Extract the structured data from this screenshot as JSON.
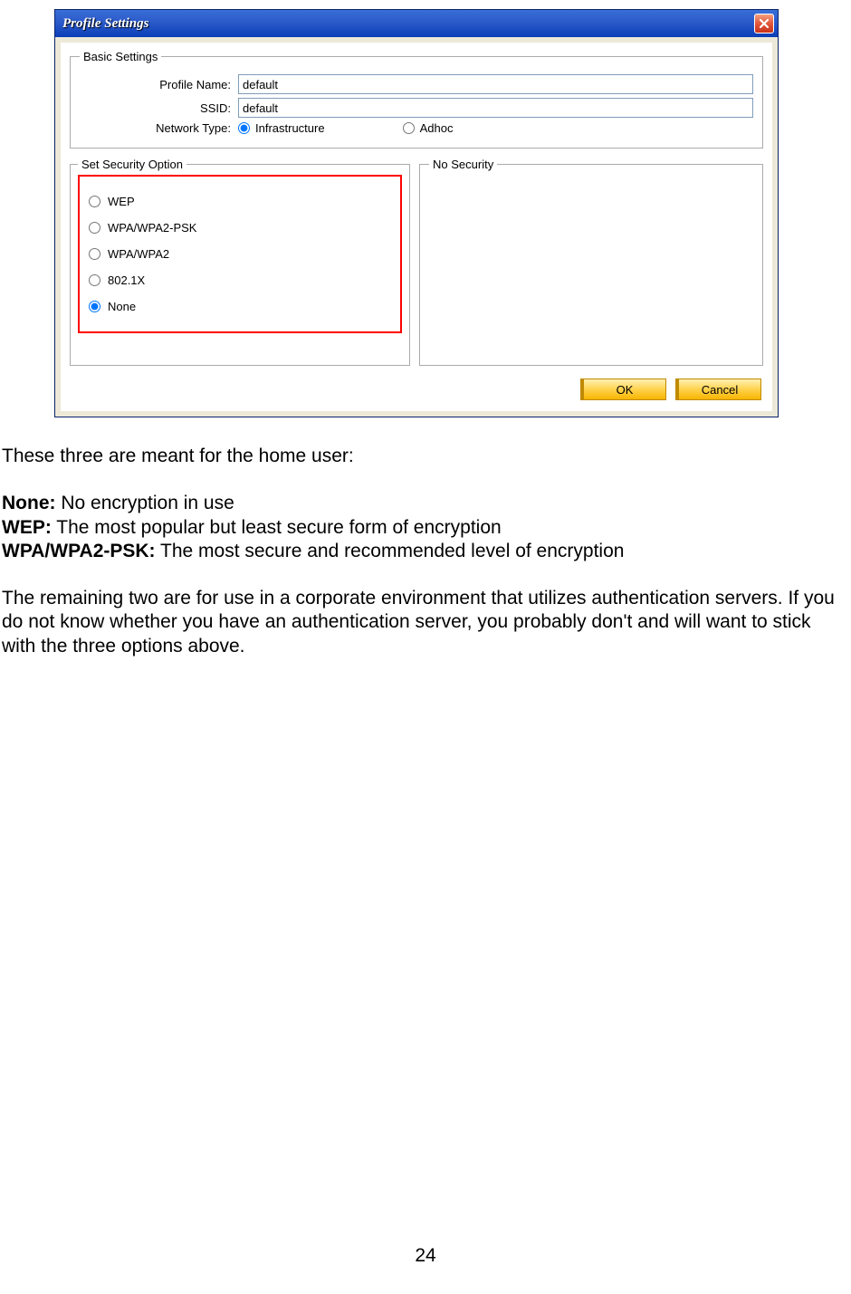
{
  "dialog": {
    "title": "Profile Settings",
    "basic": {
      "legend": "Basic Settings",
      "profile_name_label": "Profile Name:",
      "profile_name_value": "default",
      "ssid_label": "SSID:",
      "ssid_value": "default",
      "network_type_label": "Network Type:",
      "network_type_options": {
        "infra": "Infrastructure",
        "adhoc": "Adhoc"
      },
      "network_type_selected": "infra"
    },
    "security_option": {
      "legend": "Set Security Option",
      "options": [
        "WEP",
        "WPA/WPA2-PSK",
        "WPA/WPA2",
        "802.1X",
        "None"
      ],
      "selected": "None"
    },
    "security_detail": {
      "legend": "No Security"
    },
    "buttons": {
      "ok": "OK",
      "cancel": "Cancel"
    }
  },
  "doc": {
    "intro": "These three are meant for the home user:",
    "items": [
      {
        "b": "None:",
        "t": "  No encryption in use"
      },
      {
        "b": "WEP:",
        "t": "  The most popular but least secure form of encryption"
      },
      {
        "b": "WPA/WPA2-PSK:",
        "t": "  The most secure and recommended level of encryption"
      }
    ],
    "tail": "The remaining two are for use in a corporate environment that utilizes authentication servers.  If you do not know whether you have an authentication server, you probably don't and will want to stick with the three options above.",
    "page_num": "24"
  }
}
